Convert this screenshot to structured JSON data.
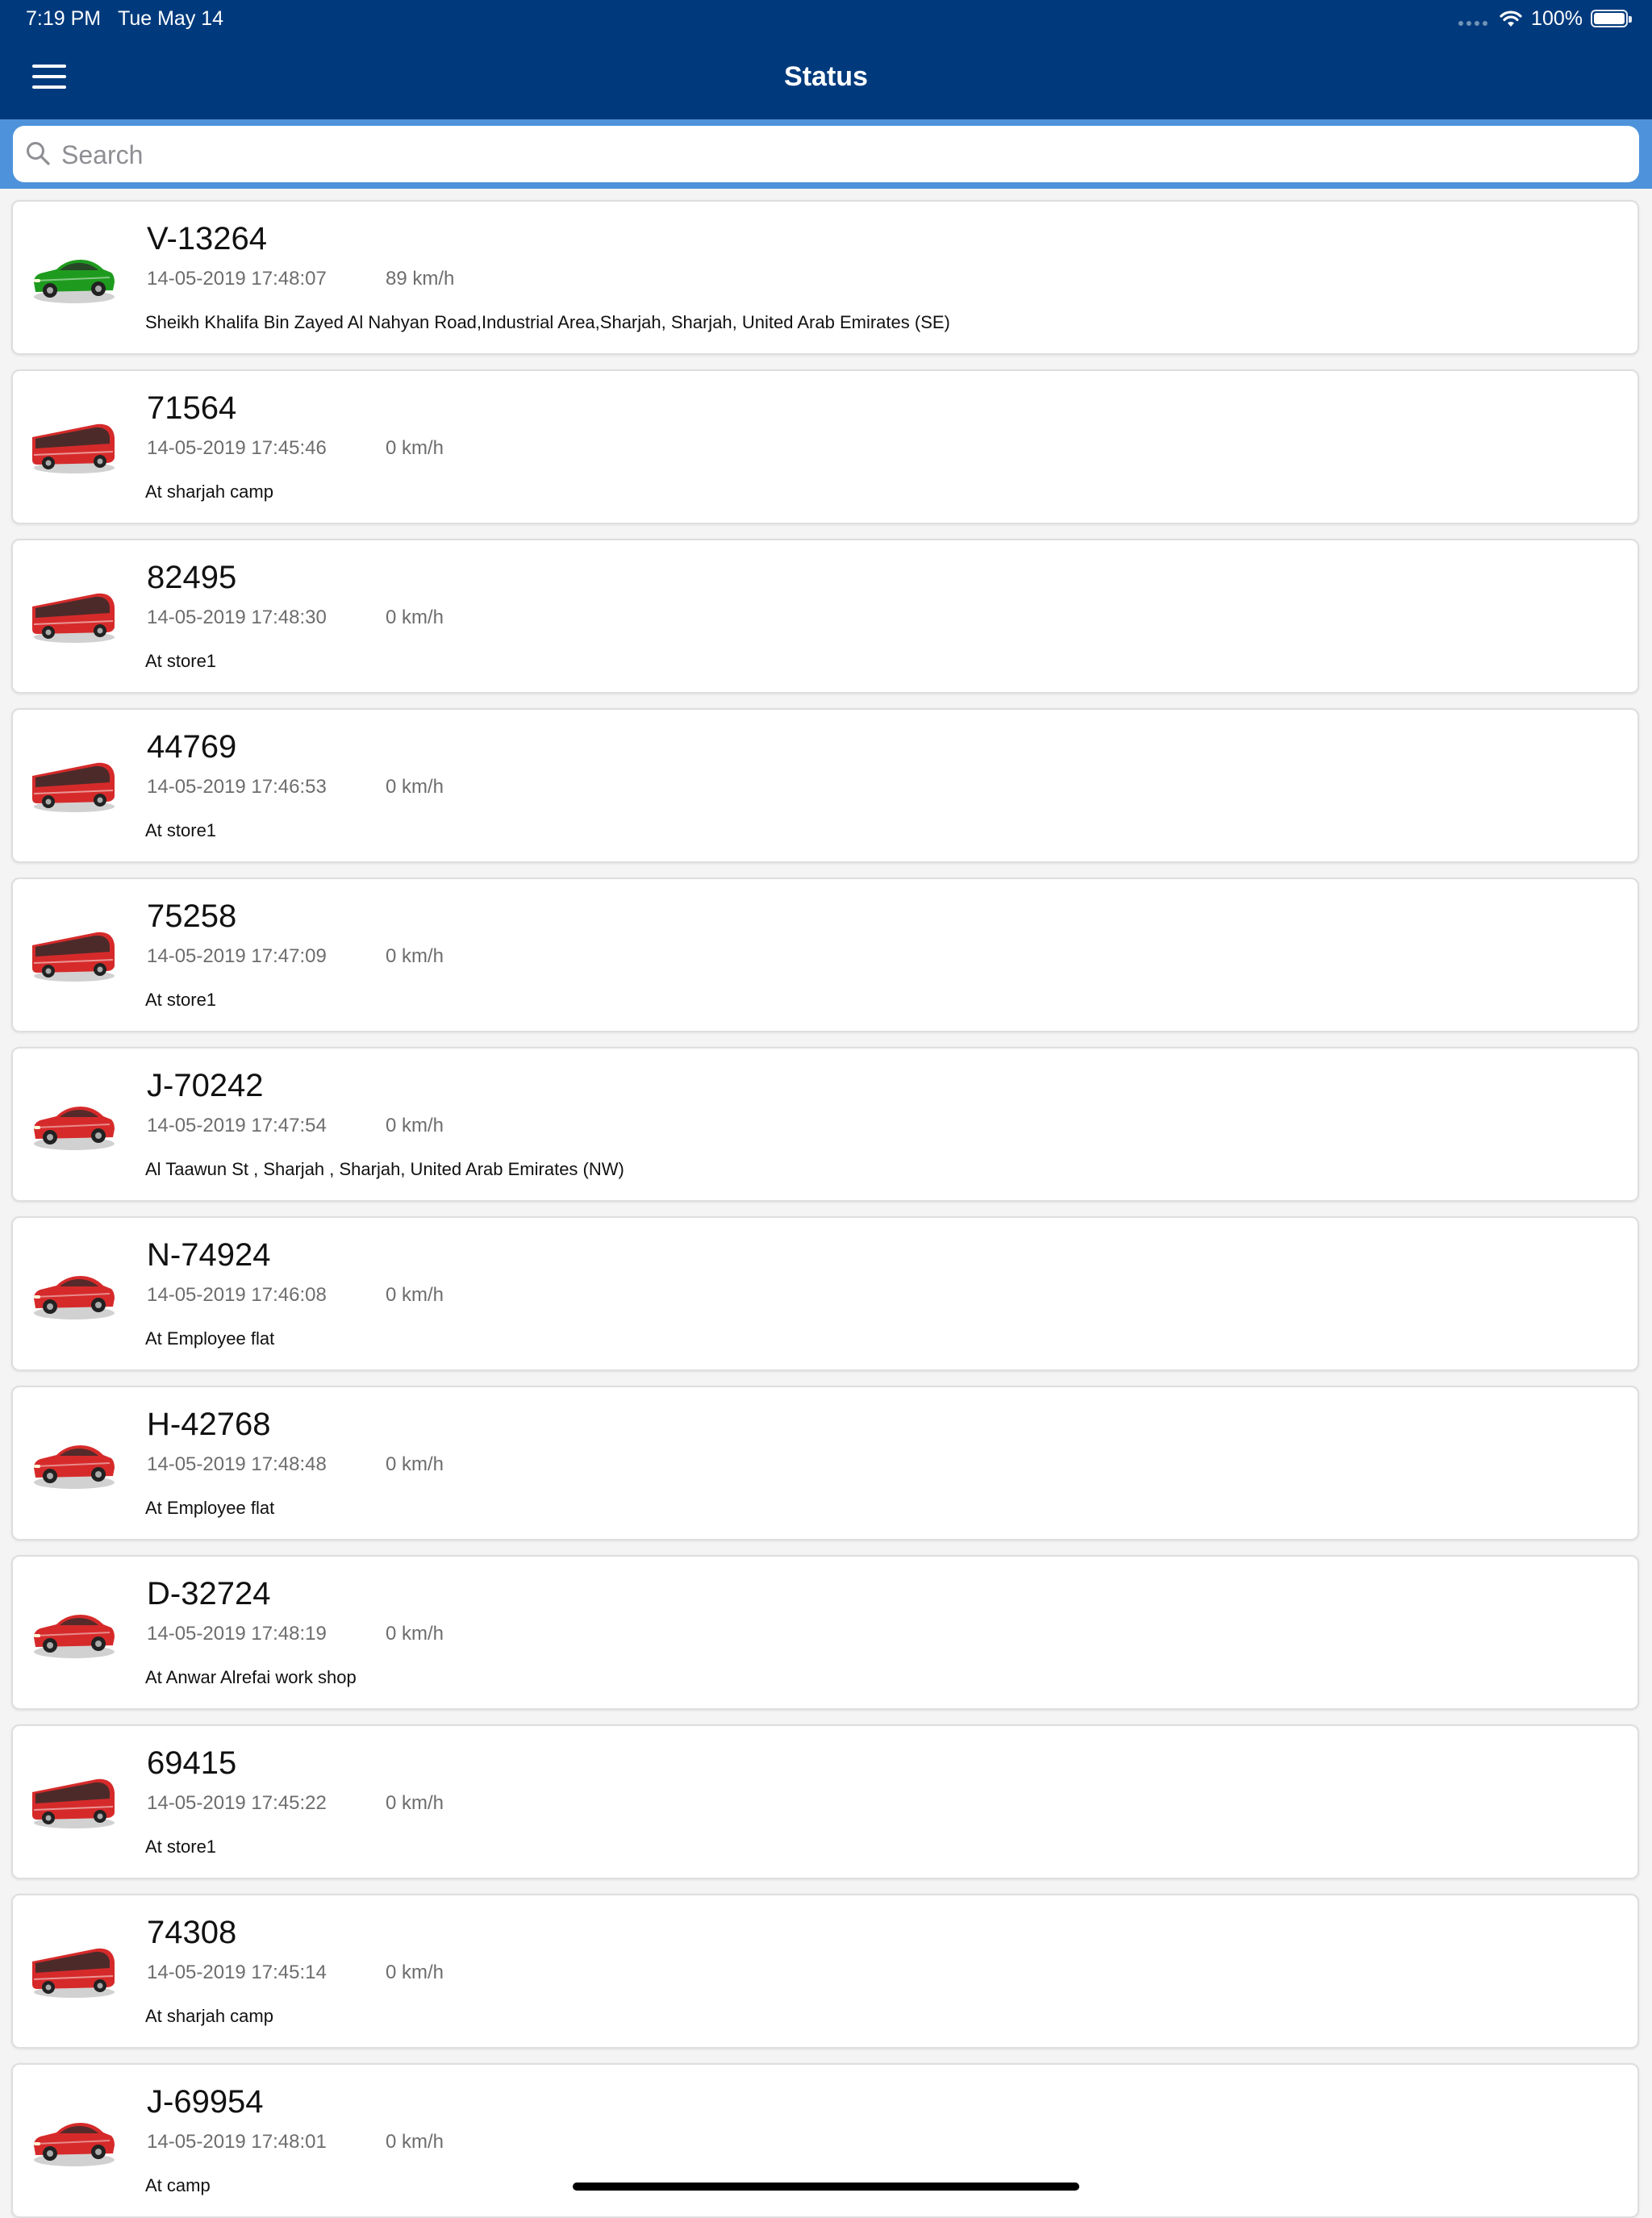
{
  "status_bar": {
    "time": "7:19 PM",
    "date": "Tue May 14",
    "battery": "100%"
  },
  "header": {
    "title": "Status",
    "menu_icon": "hamburger-menu-icon"
  },
  "search": {
    "placeholder": "Search",
    "value": ""
  },
  "vehicles": [
    {
      "id": "V-13264",
      "time": "14-05-2019 17:48:07",
      "speed": "89 km/h",
      "location": "Sheikh Khalifa Bin Zayed Al Nahyan Road,Industrial Area,Sharjah, Sharjah, United Arab Emirates (SE)",
      "icon": "car",
      "color": "#1e9b1e"
    },
    {
      "id": "71564",
      "time": "14-05-2019 17:45:46",
      "speed": "0 km/h",
      "location": "At sharjah camp",
      "icon": "bus",
      "color": "#d62a2a"
    },
    {
      "id": "82495",
      "time": "14-05-2019 17:48:30",
      "speed": "0 km/h",
      "location": "At store1",
      "icon": "bus",
      "color": "#d62a2a"
    },
    {
      "id": "44769",
      "time": "14-05-2019 17:46:53",
      "speed": "0 km/h",
      "location": "At store1",
      "icon": "bus",
      "color": "#d62a2a"
    },
    {
      "id": "75258",
      "time": "14-05-2019 17:47:09",
      "speed": "0 km/h",
      "location": "At store1",
      "icon": "bus",
      "color": "#d62a2a"
    },
    {
      "id": "J-70242",
      "time": "14-05-2019 17:47:54",
      "speed": "0 km/h",
      "location": "Al Taawun St , Sharjah , Sharjah, United Arab Emirates (NW)",
      "icon": "car",
      "color": "#d62a2a"
    },
    {
      "id": "N-74924",
      "time": "14-05-2019 17:46:08",
      "speed": "0 km/h",
      "location": "At Employee flat",
      "icon": "car",
      "color": "#d62a2a"
    },
    {
      "id": "H-42768",
      "time": "14-05-2019 17:48:48",
      "speed": "0 km/h",
      "location": "At Employee flat",
      "icon": "car",
      "color": "#d62a2a"
    },
    {
      "id": "D-32724",
      "time": "14-05-2019 17:48:19",
      "speed": "0 km/h",
      "location": "At Anwar Alrefai work shop",
      "icon": "car",
      "color": "#d62a2a"
    },
    {
      "id": "69415",
      "time": "14-05-2019 17:45:22",
      "speed": "0 km/h",
      "location": "At store1",
      "icon": "bus",
      "color": "#d62a2a"
    },
    {
      "id": "74308",
      "time": "14-05-2019 17:45:14",
      "speed": "0 km/h",
      "location": "At sharjah camp",
      "icon": "bus",
      "color": "#d62a2a"
    },
    {
      "id": "J-69954",
      "time": "14-05-2019 17:48:01",
      "speed": "0 km/h",
      "location": "At camp",
      "icon": "car",
      "color": "#d62a2a"
    }
  ]
}
